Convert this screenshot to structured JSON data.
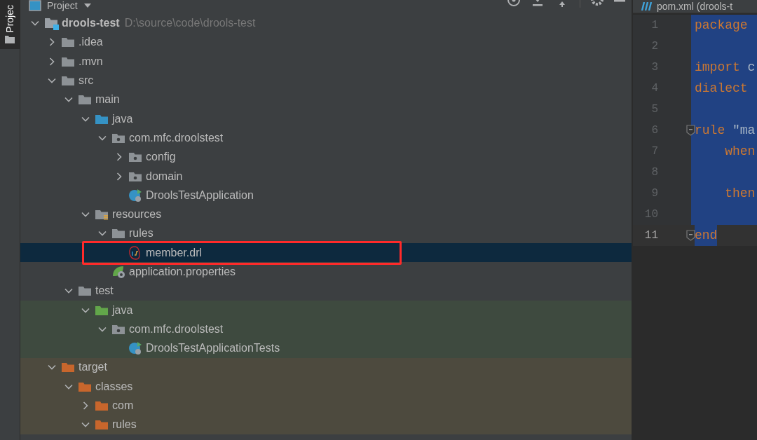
{
  "side_tab": {
    "label": "Projec",
    "selected": true
  },
  "project_panel": {
    "title": "Project"
  },
  "tree": [
    {
      "label": "drools-test",
      "path": "D:\\source\\code\\drools-test",
      "kind": "module",
      "expanded": true,
      "children": [
        {
          "label": ".idea",
          "kind": "folder",
          "expanded": false
        },
        {
          "label": ".mvn",
          "kind": "folder",
          "expanded": false
        },
        {
          "label": "src",
          "kind": "folder",
          "expanded": true,
          "children": [
            {
              "label": "main",
              "kind": "folder",
              "expanded": true,
              "children": [
                {
                  "label": "java",
                  "kind": "source",
                  "expanded": true,
                  "children": [
                    {
                      "label": "com.mfc.droolstest",
                      "kind": "package",
                      "expanded": true,
                      "children": [
                        {
                          "label": "config",
                          "kind": "package",
                          "expanded": false
                        },
                        {
                          "label": "domain",
                          "kind": "package",
                          "expanded": false
                        },
                        {
                          "label": "DroolsTestApplication",
                          "kind": "class"
                        }
                      ]
                    }
                  ]
                },
                {
                  "label": "resources",
                  "kind": "resources",
                  "expanded": true,
                  "children": [
                    {
                      "label": "rules",
                      "kind": "folder",
                      "expanded": true,
                      "children": [
                        {
                          "label": "member.drl",
                          "kind": "drl",
                          "selected": true,
                          "highlighted": true
                        }
                      ]
                    },
                    {
                      "label": "application.properties",
                      "kind": "properties"
                    }
                  ]
                }
              ]
            },
            {
              "label": "test",
              "kind": "folder",
              "expanded": true,
              "children": [
                {
                  "label": "java",
                  "kind": "test-source",
                  "color": "#3e4a3f",
                  "expanded": true,
                  "children": [
                    {
                      "label": "com.mfc.droolstest",
                      "kind": "package",
                      "color": "#3e4a3f",
                      "expanded": true,
                      "children": [
                        {
                          "label": "DroolsTestApplicationTests",
                          "kind": "class",
                          "color": "#3e4a3f"
                        }
                      ]
                    }
                  ]
                }
              ]
            }
          ]
        },
        {
          "label": "target",
          "kind": "excluded",
          "color": "#4d4a3e",
          "expanded": true,
          "children": [
            {
              "label": "classes",
              "kind": "excluded",
              "color": "#4d4a3e",
              "expanded": true,
              "children": [
                {
                  "label": "com",
                  "kind": "excluded",
                  "color": "#4d4a3e",
                  "expanded": false
                },
                {
                  "label": "rules",
                  "kind": "excluded",
                  "color": "#4d4a3e",
                  "expanded": true
                }
              ]
            }
          ]
        }
      ]
    }
  ],
  "editor": {
    "tab": "pom.xml (drools-t",
    "lines": [
      {
        "number": "1",
        "tokens": [
          {
            "text": "package",
            "kind": "keyword"
          }
        ]
      },
      {
        "number": "2"
      },
      {
        "number": "3",
        "tokens": [
          {
            "text": "import",
            "kind": "keyword"
          },
          {
            "text": " c",
            "kind": "plain"
          }
        ]
      },
      {
        "number": "4",
        "tokens": [
          {
            "text": "dialect",
            "kind": "keyword"
          }
        ]
      },
      {
        "number": "5"
      },
      {
        "number": "6",
        "fold": true,
        "tokens": [
          {
            "text": "rule",
            "kind": "keyword"
          },
          {
            "text": " \"ma",
            "kind": "plain"
          }
        ]
      },
      {
        "number": "7",
        "tokens": [
          {
            "text": "    when",
            "kind": "keyword"
          }
        ]
      },
      {
        "number": "8"
      },
      {
        "number": "9",
        "tokens": [
          {
            "text": "    then",
            "kind": "keyword"
          }
        ]
      },
      {
        "number": "10"
      },
      {
        "number": "11",
        "fold": true,
        "current": true,
        "tokens": [
          {
            "text": "end",
            "kind": "keyword"
          }
        ]
      }
    ]
  }
}
